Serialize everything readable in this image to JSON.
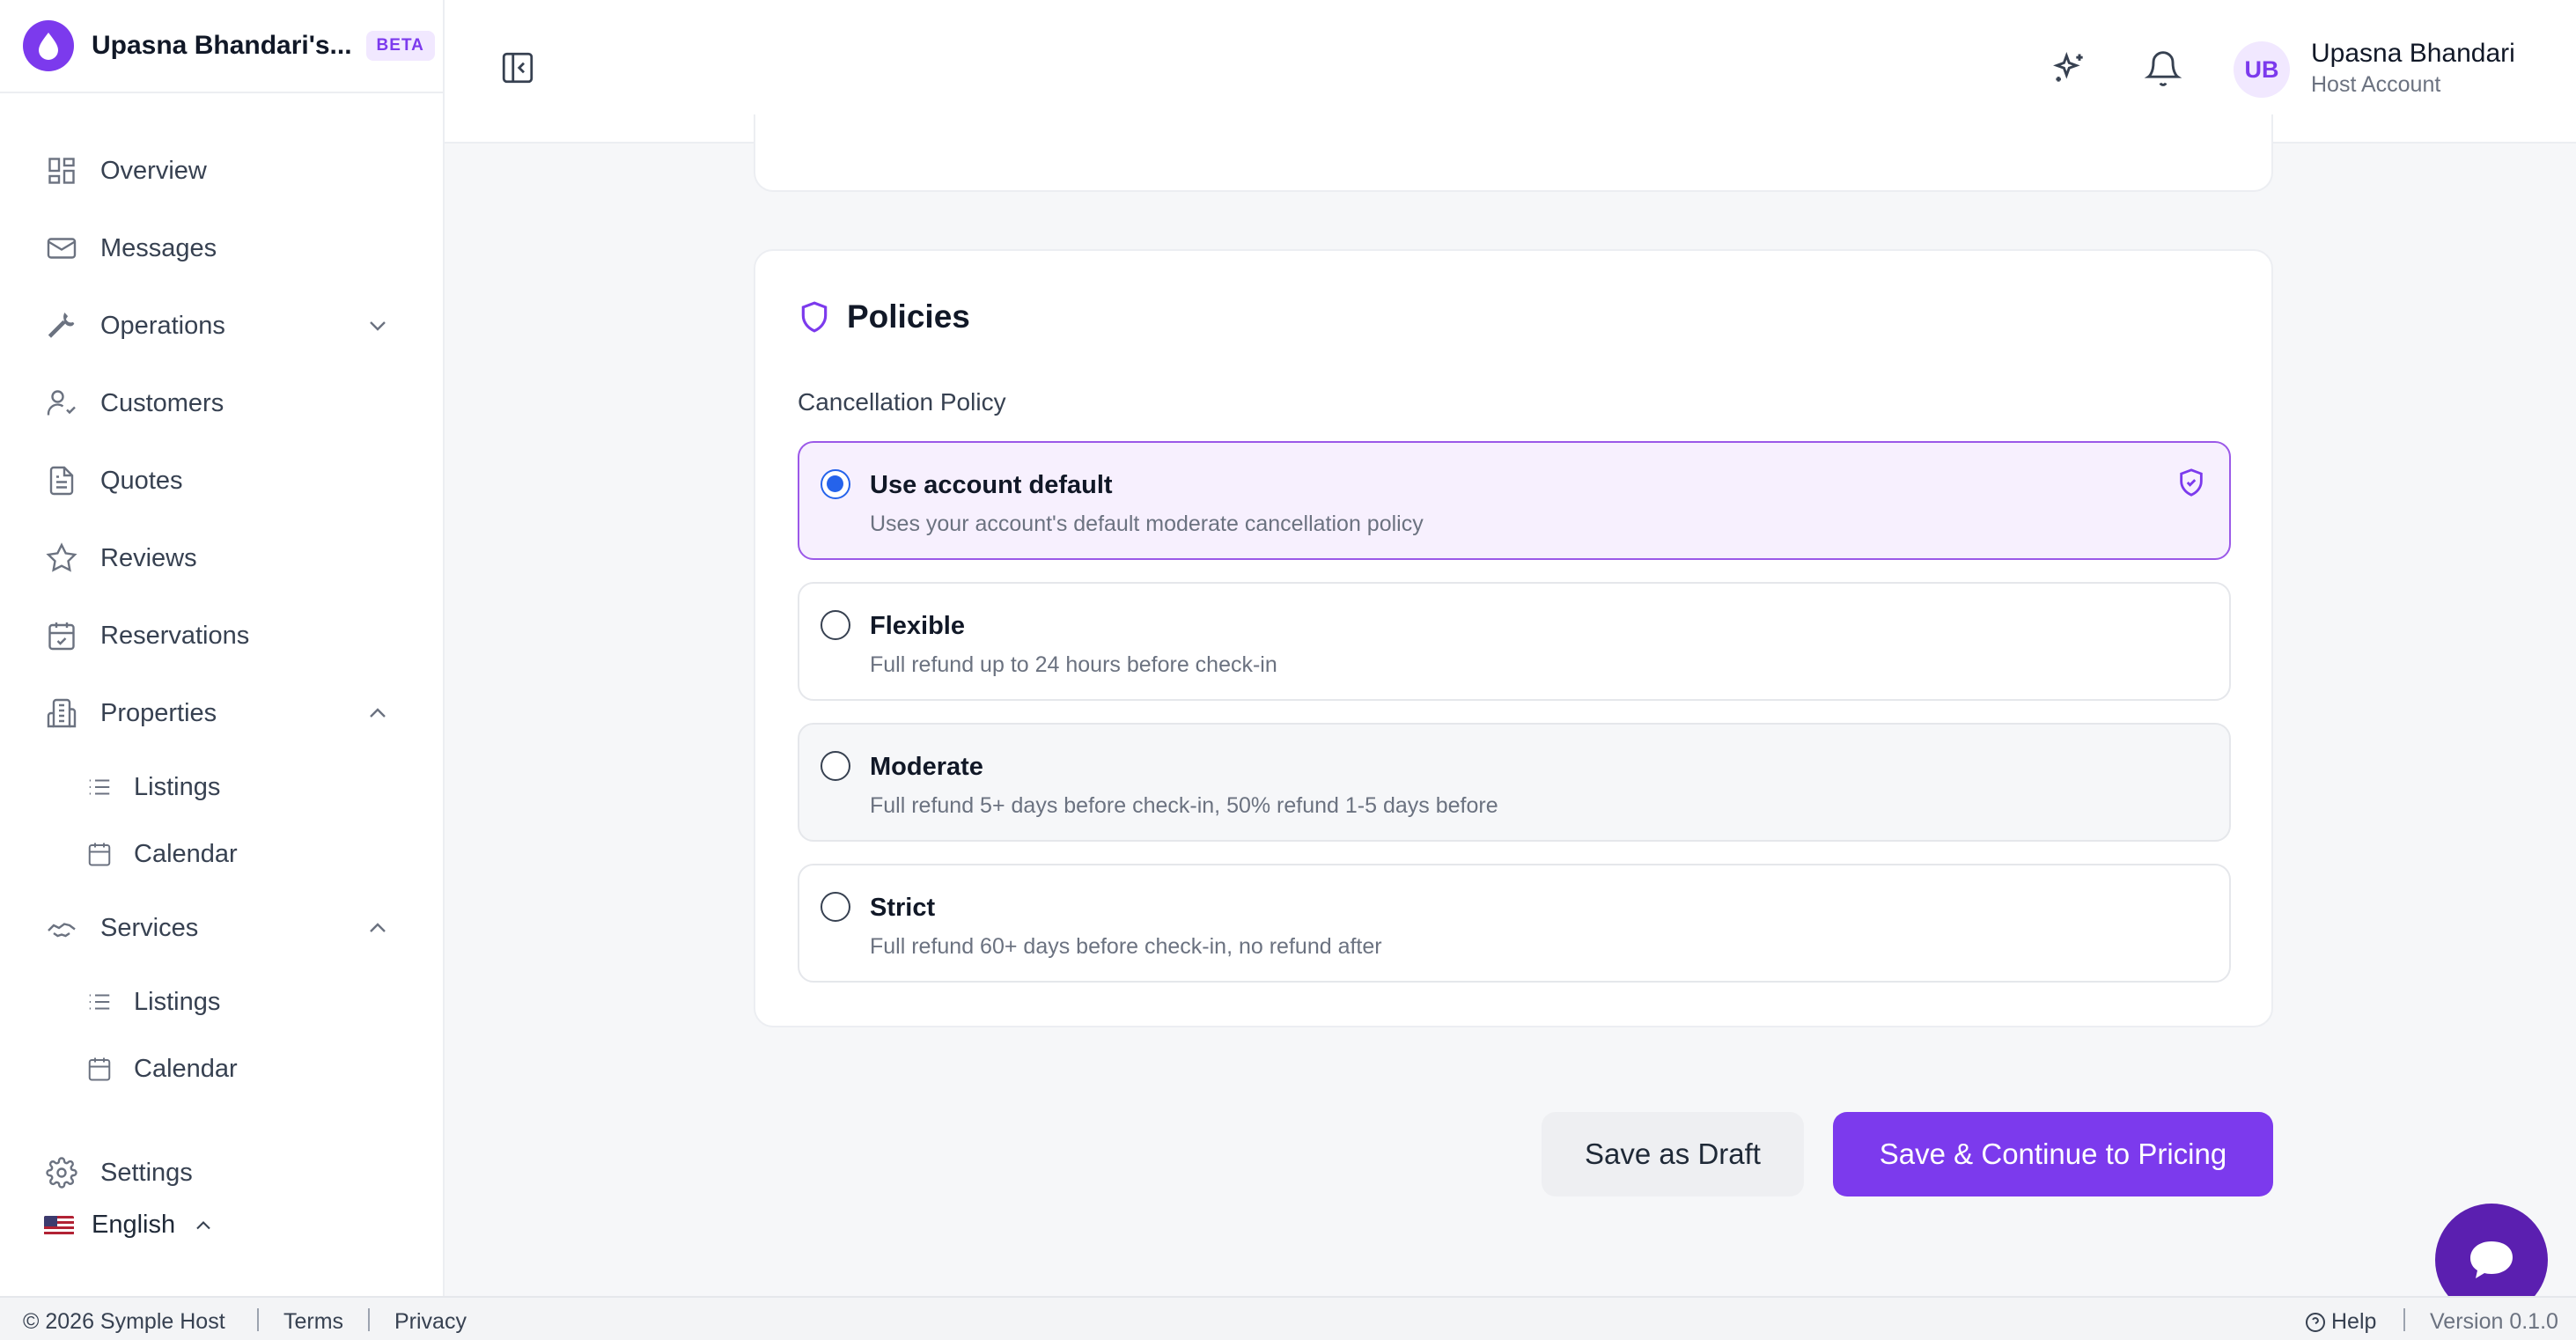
{
  "app": {
    "workspace_name": "Upasna Bhandari's...",
    "badge": "BETA"
  },
  "sidebar": {
    "items": [
      {
        "label": "Overview",
        "icon": "grid-icon"
      },
      {
        "label": "Messages",
        "icon": "mail-icon"
      },
      {
        "label": "Operations",
        "icon": "wrench-icon",
        "expanded": false
      },
      {
        "label": "Customers",
        "icon": "user-check-icon"
      },
      {
        "label": "Quotes",
        "icon": "document-icon"
      },
      {
        "label": "Reviews",
        "icon": "star-icon"
      },
      {
        "label": "Reservations",
        "icon": "calendar-check-icon"
      },
      {
        "label": "Properties",
        "icon": "building-icon",
        "expanded": true,
        "children": [
          {
            "label": "Listings",
            "icon": "list-icon"
          },
          {
            "label": "Calendar",
            "icon": "calendar-icon"
          }
        ]
      },
      {
        "label": "Services",
        "icon": "handshake-icon",
        "expanded": true,
        "children": [
          {
            "label": "Listings",
            "icon": "list-icon"
          },
          {
            "label": "Calendar",
            "icon": "calendar-icon"
          }
        ]
      },
      {
        "label": "Settings",
        "icon": "gear-icon"
      }
    ],
    "language": "English"
  },
  "header": {
    "user": {
      "initials": "UB",
      "name": "Upasna Bhandari",
      "role": "Host Account"
    }
  },
  "policies": {
    "title": "Policies",
    "field_label": "Cancellation Policy",
    "options": [
      {
        "title": "Use account default",
        "description": "Uses your account's default moderate cancellation policy",
        "selected": true
      },
      {
        "title": "Flexible",
        "description": "Full refund up to 24 hours before check-in",
        "selected": false
      },
      {
        "title": "Moderate",
        "description": "Full refund 5+ days before check-in, 50% refund 1-5 days before",
        "selected": false
      },
      {
        "title": "Strict",
        "description": "Full refund 60+ days before check-in, no refund after",
        "selected": false
      }
    ]
  },
  "actions": {
    "draft": "Save as Draft",
    "primary": "Save & Continue to Pricing"
  },
  "footer": {
    "copyright": "© 2026 Symple Host",
    "terms": "Terms",
    "privacy": "Privacy",
    "help": "Help",
    "version": "Version 0.1.0"
  },
  "colors": {
    "accent": "#7c3aed",
    "radio_checked": "#2563eb",
    "selected_bg": "#f7f0fe",
    "chat_button": "#5b1fb0"
  }
}
